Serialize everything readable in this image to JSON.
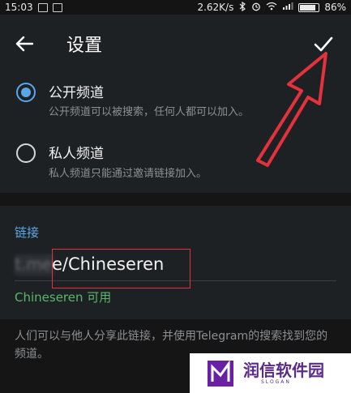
{
  "status_bar": {
    "time": "15:03",
    "speed": "2.62K/s",
    "battery": "86%",
    "battery_level": 0.86
  },
  "app_bar": {
    "title": "设置"
  },
  "channel_type": {
    "public": {
      "label": "公开频道",
      "description": "公开频道可以被搜索，任何人都可以加入。",
      "selected": true
    },
    "private": {
      "label": "私人频道",
      "description": "私人频道只能通过邀请链接加入。",
      "selected": false
    }
  },
  "link_section": {
    "header": "链接",
    "prefix": "t.me",
    "value": "e/Chineseren",
    "availability": "Chineseren 可用"
  },
  "info": {
    "text": "人们可以与他人分享此链接，并使用Telegram的搜索找到您的频道。"
  },
  "watermark": {
    "name": "润信软件园",
    "slogan": "SLOGAN"
  },
  "colors": {
    "accent": "#5aa7e8",
    "available": "#58b867",
    "annotation_red": "#e3323b",
    "watermark_purple": "#5b2a8a"
  }
}
